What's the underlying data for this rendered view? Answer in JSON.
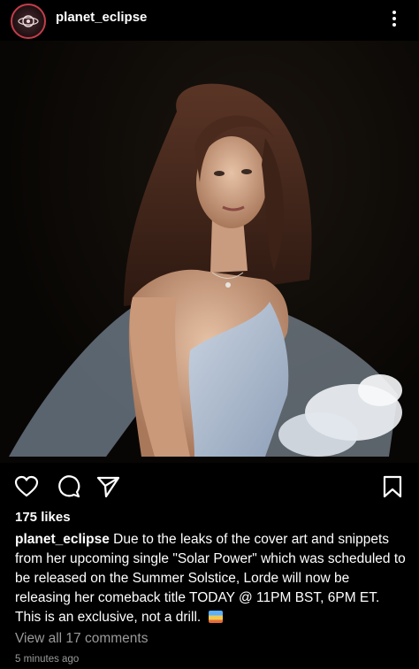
{
  "post": {
    "username": "planet_eclipse",
    "likes": "175 likes",
    "caption_username": "planet_eclipse",
    "caption_text": "Due to the leaks of the cover art and snippets from her upcoming single \"Solar Power\" which was scheduled to be released on the Summer Solstice, Lorde will now be releasing her comeback title TODAY @ 11PM BST, 6PM ET. This is an exclusive, not a drill.",
    "view_comments": "View all 17 comments",
    "timestamp": "5 minutes ago"
  },
  "icons": {
    "avatar": "planet-eclipse-logo",
    "more": "more-vertical-icon",
    "like": "heart-icon",
    "comment": "comment-icon",
    "share": "send-icon",
    "save": "bookmark-icon",
    "caption_emoji": "beach-emoji"
  },
  "colors": {
    "background": "#000000",
    "text": "#ffffff",
    "muted_text": "#9a9a9a",
    "avatar_ring": "#c43d4a"
  }
}
